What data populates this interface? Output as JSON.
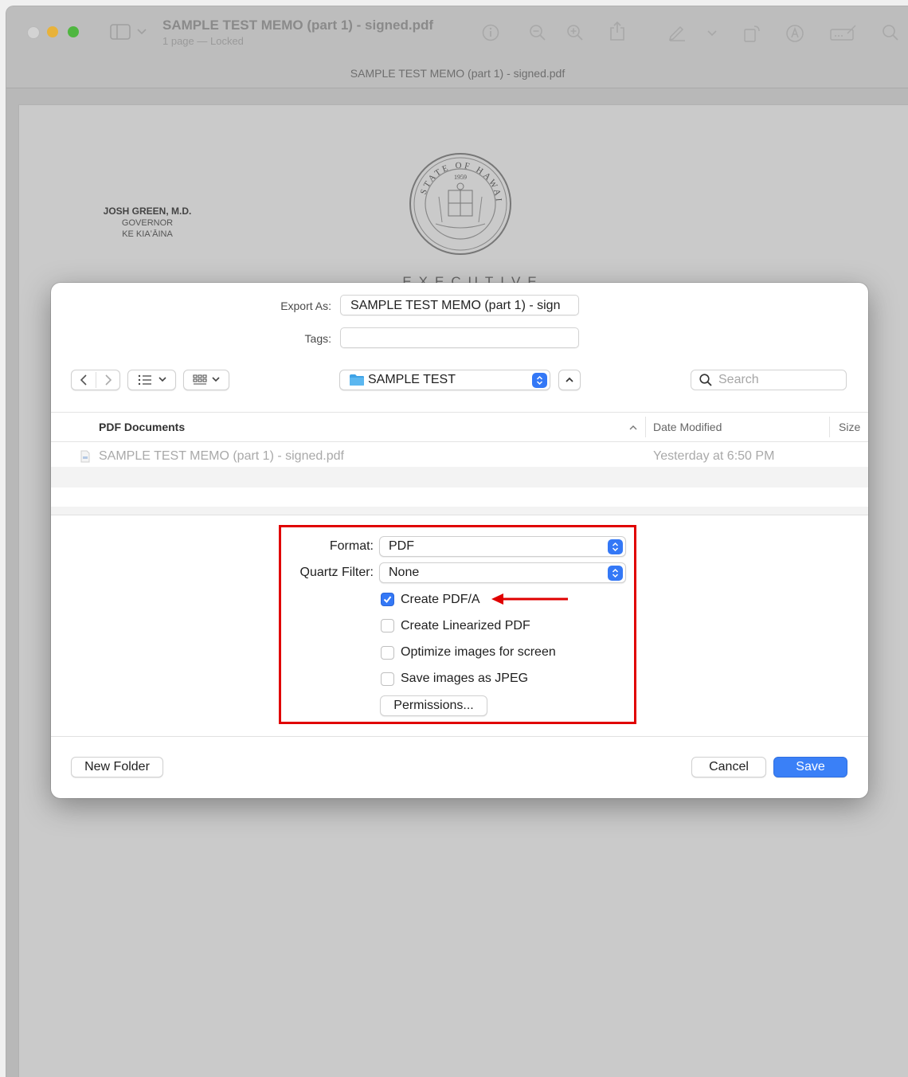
{
  "window": {
    "title": "SAMPLE TEST MEMO (part 1) - signed.pdf",
    "subtitle": "1 page — Locked",
    "tab_title": "SAMPLE TEST MEMO (part 1) - signed.pdf",
    "toolbar_icons": [
      "sidebar-icon",
      "chevron-down-icon",
      "info-icon",
      "zoom-out-icon",
      "zoom-in-icon",
      "share-icon",
      "markup-icon",
      "chevron-down-icon",
      "rotate-icon",
      "annotate-icon",
      "form-icon",
      "search-icon"
    ]
  },
  "document": {
    "governor_name": "JOSH GREEN, M.D.",
    "governor_title": "GOVERNOR",
    "governor_title_hawaiian": "KE KIAʻĀINA",
    "seal_text": "STATE OF HAWAII",
    "seal_year": "1959",
    "heading": "EXECUTIVE CHAMBERS"
  },
  "dialog": {
    "export_as_label": "Export As:",
    "export_as_value": "SAMPLE TEST MEMO (part 1) - sign",
    "tags_label": "Tags:",
    "tags_value": "",
    "location": "SAMPLE TEST",
    "search_placeholder": "Search",
    "columns": {
      "name": "PDF Documents",
      "date": "Date Modified",
      "size": "Size"
    },
    "files": [
      {
        "name": "SAMPLE TEST MEMO (part 1) - signed.pdf",
        "date": "Yesterday at 6:50 PM"
      }
    ],
    "format_label": "Format:",
    "format_value": "PDF",
    "quartz_label": "Quartz Filter:",
    "quartz_value": "None",
    "options": [
      {
        "label": "Create PDF/A",
        "checked": true
      },
      {
        "label": "Create Linearized PDF",
        "checked": false
      },
      {
        "label": "Optimize images for screen",
        "checked": false
      },
      {
        "label": "Save images as JPEG",
        "checked": false
      }
    ],
    "permissions_button": "Permissions...",
    "new_folder_button": "New Folder",
    "cancel_button": "Cancel",
    "save_button": "Save"
  },
  "colors": {
    "accent": "#3478f6",
    "highlight": "#e00000",
    "arrow": "#e00000"
  }
}
